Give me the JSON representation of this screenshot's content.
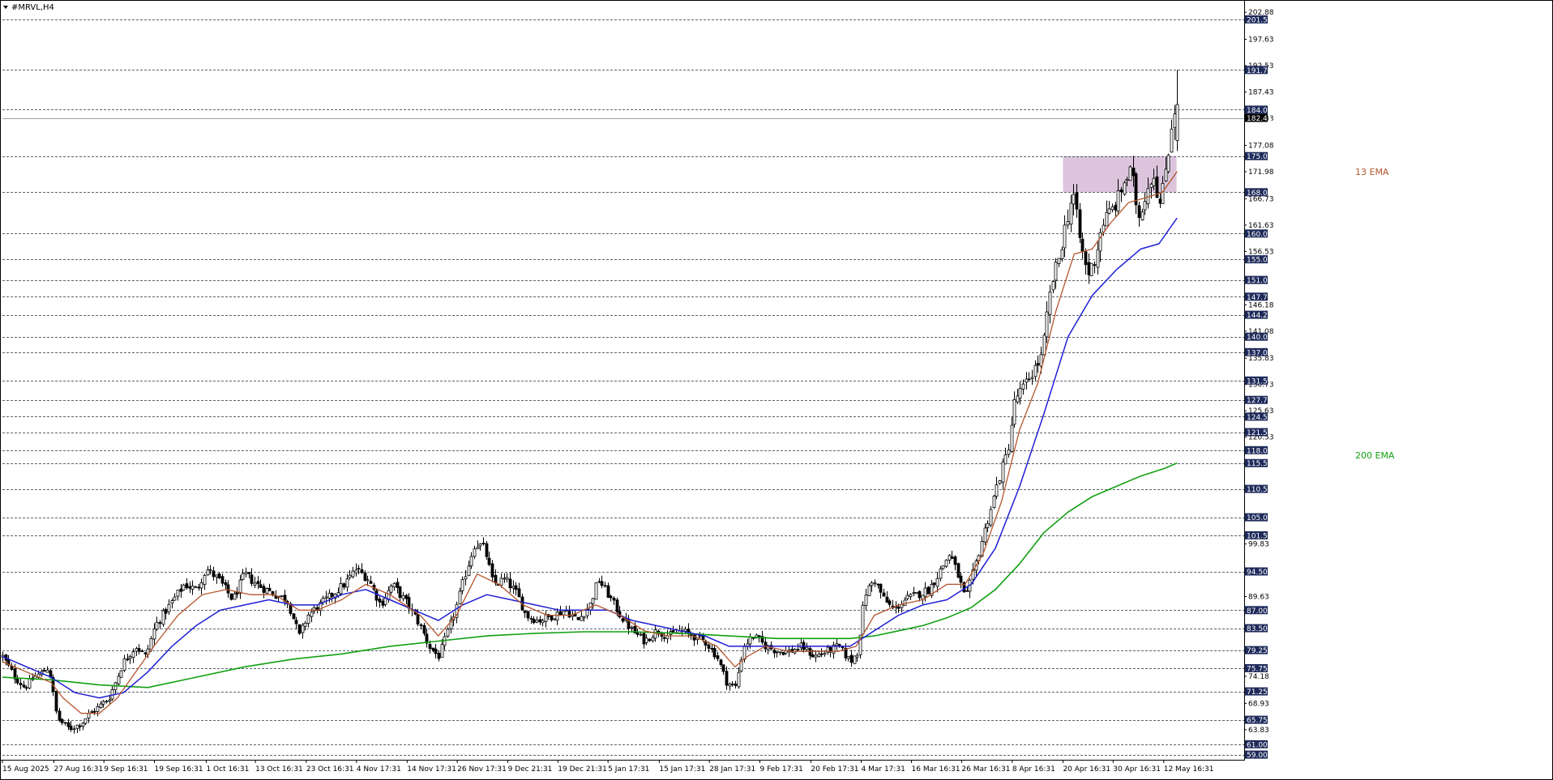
{
  "window": {
    "title": "#MRVL,H4"
  },
  "colors": {
    "background": "#ffffff",
    "grid_dash": "#2a3140",
    "candle": "#000000",
    "ema13": "#b4552d",
    "ema_blue": "#1f1fd6",
    "ema200": "#12a012",
    "zone_fill": "#d8bfd8",
    "level_box": "#1e2a5a",
    "current_box": "#000000"
  },
  "chart_data": {
    "type": "candlestick",
    "symbol": "#MRVL",
    "timeframe": "H4",
    "y_range": [
      58,
      204
    ],
    "x_range": [
      0,
      1
    ],
    "x_tick_labels": [
      "15 Aug 2025",
      "27 Aug 16:31",
      "9 Sep 16:31",
      "19 Sep 16:31",
      "1 Oct 16:31",
      "13 Oct 16:31",
      "23 Oct 16:31",
      "4 Nov 17:31",
      "14 Nov 17:31",
      "26 Nov 17:31",
      "9 Dec 21:31",
      "19 Dec 21:31",
      "5 Jan 17:31",
      "15 Jan 17:31",
      "28 Jan 17:31",
      "9 Feb 17:31",
      "20 Feb 17:31",
      "4 Mar 17:31",
      "16 Mar 16:31",
      "26 Mar 16:31",
      "8 Apr 16:31",
      "20 Apr 16:31",
      "30 Apr 16:31",
      "12 May 16:31"
    ],
    "x_tick_positions": [
      0.0,
      0.0425,
      0.0838,
      0.1255,
      0.1683,
      0.2089,
      0.2509,
      0.2924,
      0.3342,
      0.3756,
      0.4174,
      0.4587,
      0.5001,
      0.5424,
      0.5838,
      0.6255,
      0.6676,
      0.7092,
      0.7507,
      0.7921,
      0.8339,
      0.8758,
      0.9172,
      0.959
    ],
    "y_tick_labels": [
      202.88,
      197.63,
      192.53,
      187.43,
      182.33,
      177.08,
      171.98,
      166.73,
      161.63,
      156.53,
      146.18,
      141.08,
      135.83,
      130.73,
      125.63,
      120.53,
      99.83,
      89.63,
      74.18,
      68.93,
      63.83
    ],
    "price_levels": [
      201.5,
      191.7,
      184.0,
      175.0,
      168.0,
      160.0,
      155.0,
      151.0,
      147.75,
      144.25,
      140.0,
      137.0,
      131.5,
      127.75,
      124.5,
      121.5,
      118.0,
      115.5,
      110.5,
      105.0,
      101.5,
      94.5,
      87.0,
      83.5,
      79.25,
      75.75,
      71.25,
      65.75,
      61.0,
      59.0
    ],
    "price_level_labels": [
      "201.50",
      "191.70",
      "184.00",
      "175.00",
      "168.00",
      "160.00",
      "155.00",
      "151.00",
      "147.75",
      "144.25",
      "140.00",
      "137.00",
      "131.50",
      "127.75",
      "124.50",
      "121.50",
      "118.00",
      "115.50",
      "110.50",
      "105.00",
      "101.50",
      "94.50",
      "87.00",
      "83.50",
      "79.25",
      "75.75",
      "71.25",
      "65.75",
      "61.00",
      "59.00"
    ],
    "current_price": 182.41,
    "current_price_label": "182.41",
    "zone": {
      "low": 168.0,
      "high": 175.0,
      "x_start": 0.8758,
      "x_end": 0.9696
    },
    "close_path": [
      [
        0.0,
        78
      ],
      [
        0.01,
        74
      ],
      [
        0.018,
        72
      ],
      [
        0.026,
        74
      ],
      [
        0.033,
        75
      ],
      [
        0.038,
        76
      ],
      [
        0.045,
        66
      ],
      [
        0.055,
        64
      ],
      [
        0.065,
        65
      ],
      [
        0.072,
        67
      ],
      [
        0.078,
        68
      ],
      [
        0.088,
        70
      ],
      [
        0.1,
        77
      ],
      [
        0.11,
        80
      ],
      [
        0.118,
        78
      ],
      [
        0.126,
        84
      ],
      [
        0.138,
        88
      ],
      [
        0.15,
        92
      ],
      [
        0.16,
        91
      ],
      [
        0.168,
        95
      ],
      [
        0.178,
        93
      ],
      [
        0.19,
        89
      ],
      [
        0.2,
        94
      ],
      [
        0.21,
        92
      ],
      [
        0.225,
        90
      ],
      [
        0.235,
        89
      ],
      [
        0.245,
        82
      ],
      [
        0.252,
        86
      ],
      [
        0.262,
        88
      ],
      [
        0.272,
        90
      ],
      [
        0.282,
        92
      ],
      [
        0.292,
        95
      ],
      [
        0.302,
        93
      ],
      [
        0.312,
        88
      ],
      [
        0.322,
        92
      ],
      [
        0.335,
        88
      ],
      [
        0.345,
        84
      ],
      [
        0.352,
        80
      ],
      [
        0.36,
        78
      ],
      [
        0.368,
        83
      ],
      [
        0.375,
        88
      ],
      [
        0.382,
        94
      ],
      [
        0.39,
        100
      ],
      [
        0.398,
        99
      ],
      [
        0.405,
        92
      ],
      [
        0.415,
        93
      ],
      [
        0.425,
        90
      ],
      [
        0.432,
        86
      ],
      [
        0.442,
        85
      ],
      [
        0.455,
        86
      ],
      [
        0.465,
        87
      ],
      [
        0.475,
        85
      ],
      [
        0.485,
        88
      ],
      [
        0.492,
        93
      ],
      [
        0.5,
        90
      ],
      [
        0.51,
        86
      ],
      [
        0.52,
        83
      ],
      [
        0.53,
        81
      ],
      [
        0.54,
        83
      ],
      [
        0.55,
        82
      ],
      [
        0.56,
        83
      ],
      [
        0.57,
        82
      ],
      [
        0.58,
        81
      ],
      [
        0.59,
        78
      ],
      [
        0.598,
        73
      ],
      [
        0.605,
        72
      ],
      [
        0.612,
        80
      ],
      [
        0.62,
        82
      ],
      [
        0.63,
        80
      ],
      [
        0.64,
        79
      ],
      [
        0.65,
        79
      ],
      [
        0.66,
        80
      ],
      [
        0.67,
        78
      ],
      [
        0.68,
        79
      ],
      [
        0.69,
        80
      ],
      [
        0.7,
        77
      ],
      [
        0.706,
        79
      ],
      [
        0.712,
        90
      ],
      [
        0.72,
        93
      ],
      [
        0.728,
        89
      ],
      [
        0.736,
        87
      ],
      [
        0.745,
        89
      ],
      [
        0.755,
        90
      ],
      [
        0.765,
        91
      ],
      [
        0.775,
        95
      ],
      [
        0.782,
        98
      ],
      [
        0.79,
        93
      ],
      [
        0.795,
        89
      ],
      [
        0.8,
        93
      ],
      [
        0.808,
        100
      ],
      [
        0.815,
        106
      ],
      [
        0.822,
        112
      ],
      [
        0.83,
        118
      ],
      [
        0.836,
        128
      ],
      [
        0.843,
        130
      ],
      [
        0.85,
        133
      ],
      [
        0.858,
        136
      ],
      [
        0.866,
        150
      ],
      [
        0.872,
        155
      ],
      [
        0.878,
        162
      ],
      [
        0.884,
        168
      ],
      [
        0.89,
        158
      ],
      [
        0.896,
        152
      ],
      [
        0.902,
        155
      ],
      [
        0.908,
        162
      ],
      [
        0.914,
        164
      ],
      [
        0.92,
        166
      ],
      [
        0.926,
        170
      ],
      [
        0.932,
        172
      ],
      [
        0.938,
        163
      ],
      [
        0.944,
        168
      ],
      [
        0.95,
        172
      ],
      [
        0.956,
        165
      ],
      [
        0.96,
        172
      ],
      [
        0.964,
        178
      ],
      [
        0.967,
        185
      ],
      [
        0.97,
        182.4
      ]
    ],
    "ema13_path": [
      [
        0.0,
        77
      ],
      [
        0.02,
        75
      ],
      [
        0.04,
        73
      ],
      [
        0.05,
        70
      ],
      [
        0.065,
        67
      ],
      [
        0.08,
        67
      ],
      [
        0.095,
        70
      ],
      [
        0.11,
        75
      ],
      [
        0.125,
        80
      ],
      [
        0.145,
        86
      ],
      [
        0.165,
        90
      ],
      [
        0.185,
        91
      ],
      [
        0.205,
        90
      ],
      [
        0.225,
        90
      ],
      [
        0.245,
        87
      ],
      [
        0.26,
        87
      ],
      [
        0.28,
        89
      ],
      [
        0.3,
        92
      ],
      [
        0.32,
        90
      ],
      [
        0.345,
        86
      ],
      [
        0.36,
        82
      ],
      [
        0.375,
        86
      ],
      [
        0.392,
        94
      ],
      [
        0.41,
        92
      ],
      [
        0.43,
        88
      ],
      [
        0.45,
        86
      ],
      [
        0.47,
        86
      ],
      [
        0.49,
        88
      ],
      [
        0.51,
        86
      ],
      [
        0.53,
        83
      ],
      [
        0.55,
        82
      ],
      [
        0.57,
        82
      ],
      [
        0.59,
        80
      ],
      [
        0.605,
        76
      ],
      [
        0.615,
        78
      ],
      [
        0.63,
        80
      ],
      [
        0.65,
        79
      ],
      [
        0.67,
        79
      ],
      [
        0.69,
        79
      ],
      [
        0.705,
        80
      ],
      [
        0.72,
        86
      ],
      [
        0.74,
        88
      ],
      [
        0.76,
        89
      ],
      [
        0.78,
        92
      ],
      [
        0.795,
        92
      ],
      [
        0.81,
        98
      ],
      [
        0.825,
        108
      ],
      [
        0.84,
        122
      ],
      [
        0.855,
        131
      ],
      [
        0.87,
        145
      ],
      [
        0.885,
        156
      ],
      [
        0.9,
        157
      ],
      [
        0.915,
        162
      ],
      [
        0.93,
        166
      ],
      [
        0.945,
        167
      ],
      [
        0.958,
        168
      ],
      [
        0.97,
        172
      ]
    ],
    "ema_blue_path": [
      [
        0.0,
        78
      ],
      [
        0.02,
        76
      ],
      [
        0.04,
        74
      ],
      [
        0.06,
        71
      ],
      [
        0.08,
        70
      ],
      [
        0.1,
        71
      ],
      [
        0.12,
        75
      ],
      [
        0.14,
        80
      ],
      [
        0.16,
        84
      ],
      [
        0.18,
        87
      ],
      [
        0.2,
        88
      ],
      [
        0.22,
        89
      ],
      [
        0.24,
        88
      ],
      [
        0.26,
        88
      ],
      [
        0.28,
        90
      ],
      [
        0.3,
        91
      ],
      [
        0.32,
        89
      ],
      [
        0.34,
        87
      ],
      [
        0.36,
        85
      ],
      [
        0.38,
        88
      ],
      [
        0.4,
        90
      ],
      [
        0.42,
        89
      ],
      [
        0.44,
        88
      ],
      [
        0.46,
        87
      ],
      [
        0.48,
        87
      ],
      [
        0.5,
        87
      ],
      [
        0.52,
        85
      ],
      [
        0.54,
        84
      ],
      [
        0.56,
        83
      ],
      [
        0.58,
        82
      ],
      [
        0.6,
        80
      ],
      [
        0.62,
        80
      ],
      [
        0.64,
        80
      ],
      [
        0.66,
        80
      ],
      [
        0.68,
        80
      ],
      [
        0.7,
        80
      ],
      [
        0.72,
        83
      ],
      [
        0.74,
        86
      ],
      [
        0.76,
        88
      ],
      [
        0.78,
        89
      ],
      [
        0.8,
        92
      ],
      [
        0.82,
        99
      ],
      [
        0.84,
        111
      ],
      [
        0.86,
        125
      ],
      [
        0.88,
        140
      ],
      [
        0.9,
        148
      ],
      [
        0.92,
        153
      ],
      [
        0.94,
        157
      ],
      [
        0.955,
        158
      ],
      [
        0.97,
        163
      ]
    ],
    "ema200_path": [
      [
        0.0,
        74
      ],
      [
        0.04,
        73.5
      ],
      [
        0.08,
        72.5
      ],
      [
        0.12,
        72
      ],
      [
        0.16,
        74
      ],
      [
        0.2,
        76
      ],
      [
        0.24,
        77.5
      ],
      [
        0.28,
        78.5
      ],
      [
        0.32,
        80
      ],
      [
        0.36,
        81
      ],
      [
        0.4,
        82
      ],
      [
        0.44,
        82.5
      ],
      [
        0.48,
        82.8
      ],
      [
        0.52,
        82.8
      ],
      [
        0.56,
        82.5
      ],
      [
        0.6,
        82
      ],
      [
        0.64,
        81.5
      ],
      [
        0.68,
        81.5
      ],
      [
        0.7,
        81.5
      ],
      [
        0.72,
        82
      ],
      [
        0.74,
        83
      ],
      [
        0.76,
        84
      ],
      [
        0.78,
        85.5
      ],
      [
        0.8,
        87.5
      ],
      [
        0.82,
        91
      ],
      [
        0.84,
        96
      ],
      [
        0.86,
        102
      ],
      [
        0.88,
        106
      ],
      [
        0.9,
        109
      ],
      [
        0.92,
        111
      ],
      [
        0.94,
        113
      ],
      [
        0.96,
        114.5
      ],
      [
        0.97,
        115.5
      ]
    ],
    "annotations": [
      {
        "text": "13 EMA",
        "price": 172,
        "color_key": "ema13"
      },
      {
        "text": "200 EMA",
        "price": 117,
        "color_key": "ema200"
      }
    ]
  }
}
